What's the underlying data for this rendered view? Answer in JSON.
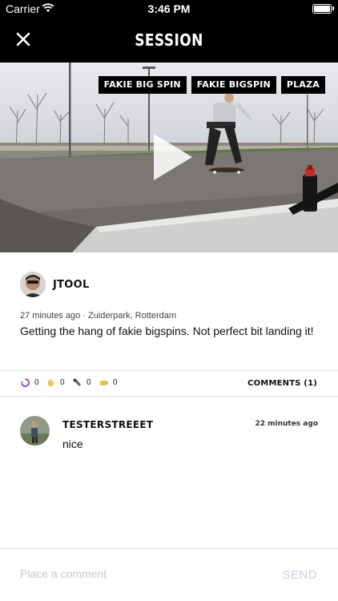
{
  "status_bar": {
    "carrier": "Carrier",
    "time": "3:46 PM"
  },
  "nav": {
    "title": "SESSION"
  },
  "video": {
    "tags": [
      "FAKIE BIG SPIN",
      "FAKIE BIGSPIN",
      "PLAZA"
    ]
  },
  "post": {
    "username": "JTOOL",
    "meta": "27 minutes ago · Zuiderpark, Rotterdam",
    "caption": "Getting the hang of fakie bigspins. Not perfect bit landing it!"
  },
  "stats": {
    "reactions": [
      {
        "icon": "spin-icon",
        "count": "0"
      },
      {
        "icon": "hand-icon",
        "count": "0"
      },
      {
        "icon": "tool-icon",
        "count": "0"
      },
      {
        "icon": "fist-icon",
        "count": "0"
      }
    ],
    "comments_label": "COMMENTS (1)"
  },
  "comment": {
    "username": "TESTERSTREEET",
    "time": "22 minutes ago",
    "text": "nice"
  },
  "composer": {
    "placeholder": "Place a comment",
    "send_label": "SEND"
  },
  "colors": {
    "bar_bg": "#000000",
    "send": "#c7cde6",
    "accent_purple": "#8b3fd0",
    "accent_yellow": "#f2c230"
  }
}
